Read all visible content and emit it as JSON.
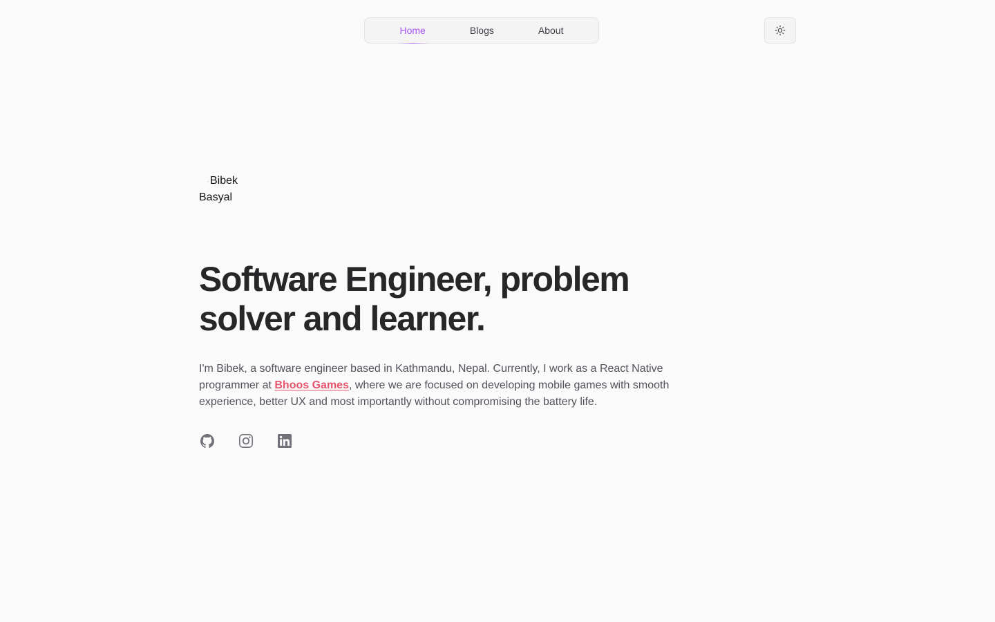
{
  "nav": {
    "items": [
      {
        "label": "Home",
        "active": true
      },
      {
        "label": "Blogs",
        "active": false
      },
      {
        "label": "About",
        "active": false
      }
    ],
    "accent_color": "#a855f7"
  },
  "theme_toggle": {
    "icon": "sun-icon"
  },
  "avatar": {
    "alt_line1": "Bibek",
    "alt_line2": "Basyal"
  },
  "hero": {
    "title": "Software Engineer, problem solver and learner.",
    "bio_before": "I'm Bibek, a software engineer based in Kathmandu, Nepal. Currently, I work as a React Native programmer at ",
    "company_link": "Bhoos Games",
    "bio_after": ", where we are focused on developing mobile games with smooth experience, better UX and most importantly without compromising the battery life.",
    "link_color": "#e5566e"
  },
  "social": [
    {
      "icon": "github-icon"
    },
    {
      "icon": "instagram-icon"
    },
    {
      "icon": "linkedin-icon"
    }
  ]
}
